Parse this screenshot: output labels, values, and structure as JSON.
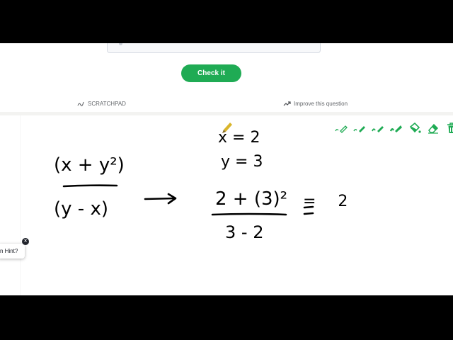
{
  "check_button": {
    "label": "Check it"
  },
  "scratchpad": {
    "label": "SCRATCHPAD"
  },
  "improve": {
    "label": "Improve this question"
  },
  "toolbar": {
    "icons": [
      "pencil-icon",
      "pen-icon",
      "pen-green-icon",
      "pen-thick-icon",
      "fill-bucket-icon",
      "eraser-icon",
      "trash-icon",
      "close-icon"
    ],
    "accent": "#1fab54"
  },
  "hint": {
    "label": "n Hint?"
  },
  "work": {
    "left_numerator": "(x + y²)",
    "left_denominator": "(y - x)",
    "given_x": "x = 2",
    "given_y": "y = 3",
    "right_numerator": "2 + (3)²",
    "right_denominator": "3 - 2",
    "result": "= 2"
  },
  "colors": {
    "ink": "#000000",
    "button": "#1fab54",
    "pencil": "#d9b52b"
  }
}
